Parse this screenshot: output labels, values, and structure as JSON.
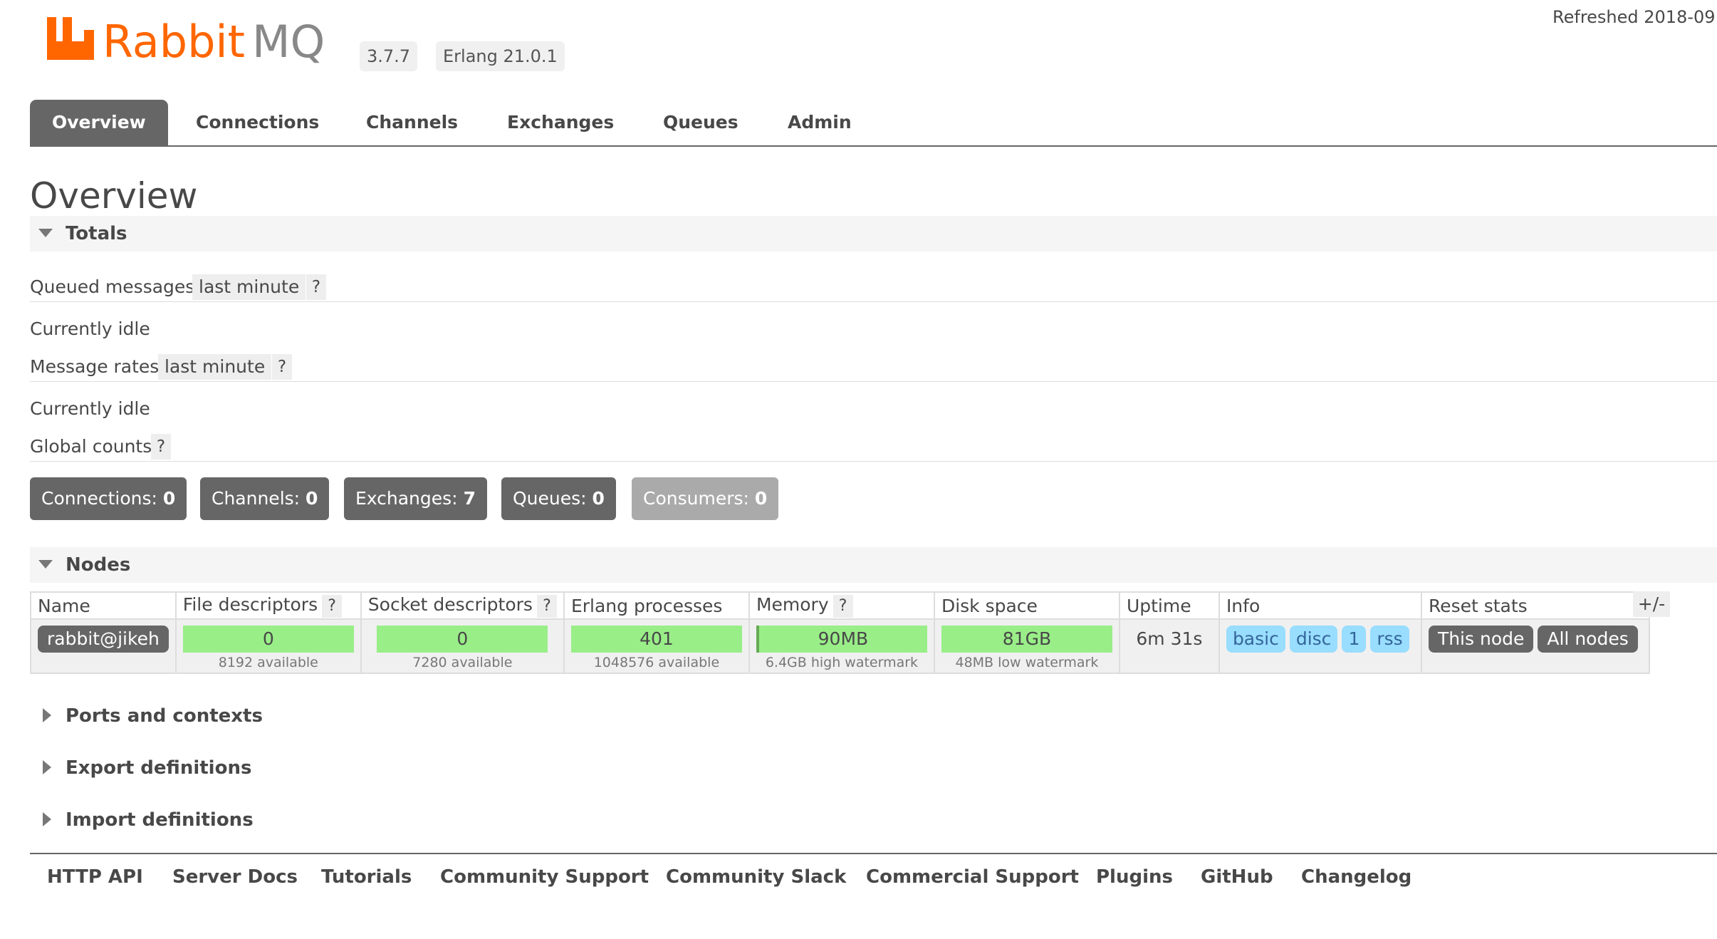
{
  "header": {
    "logo_text": "RabbitMQ",
    "version": "3.7.7",
    "erlang": "Erlang 21.0.1",
    "refreshed": "Refreshed 2018-09"
  },
  "tabs": [
    "Overview",
    "Connections",
    "Channels",
    "Exchanges",
    "Queues",
    "Admin"
  ],
  "page_title": "Overview",
  "totals": {
    "label": "Totals",
    "queued_messages": {
      "label": "Queued messages",
      "range": "last minute",
      "help": "?"
    },
    "queued_status": "Currently idle",
    "message_rates": {
      "label": "Message rates",
      "range": "last minute",
      "help": "?"
    },
    "rates_status": "Currently idle",
    "global_counts": {
      "label": "Global counts",
      "help": "?"
    },
    "counts": [
      {
        "label": "Connections:",
        "value": "0"
      },
      {
        "label": "Channels:",
        "value": "0"
      },
      {
        "label": "Exchanges:",
        "value": "7"
      },
      {
        "label": "Queues:",
        "value": "0"
      },
      {
        "label": "Consumers:",
        "value": "0"
      }
    ]
  },
  "nodes": {
    "label": "Nodes",
    "toggle": "+/-",
    "columns": [
      "Name",
      "File descriptors",
      "Socket descriptors",
      "Erlang processes",
      "Memory",
      "Disk space",
      "Uptime",
      "Info",
      "Reset stats"
    ],
    "help": "?",
    "row": {
      "name": "rabbit@jikeh",
      "file_descriptors": "0",
      "file_descriptors_sub": "8192 available",
      "socket_descriptors": "0",
      "socket_descriptors_sub": "7280 available",
      "erlang_processes": "401",
      "erlang_processes_sub": "1048576 available",
      "memory": "90MB",
      "memory_sub": "6.4GB high watermark",
      "disk_space": "81GB",
      "disk_space_sub": "48MB low watermark",
      "uptime": "6m 31s",
      "info_tags": [
        "basic",
        "disc",
        "1",
        "rss"
      ],
      "reset_this": "This node",
      "reset_all": "All nodes"
    }
  },
  "sections": [
    "Ports and contexts",
    "Export definitions",
    "Import definitions"
  ],
  "footer_links": [
    "HTTP API",
    "Server Docs",
    "Tutorials",
    "Community Support",
    "Community Slack",
    "Commercial Support",
    "Plugins",
    "GitHub",
    "Changelog"
  ],
  "colors": {
    "brand_orange": "#f60",
    "tab_active": "#666666",
    "green_bar": "#99ee88",
    "info_tag": "#99ddff"
  }
}
